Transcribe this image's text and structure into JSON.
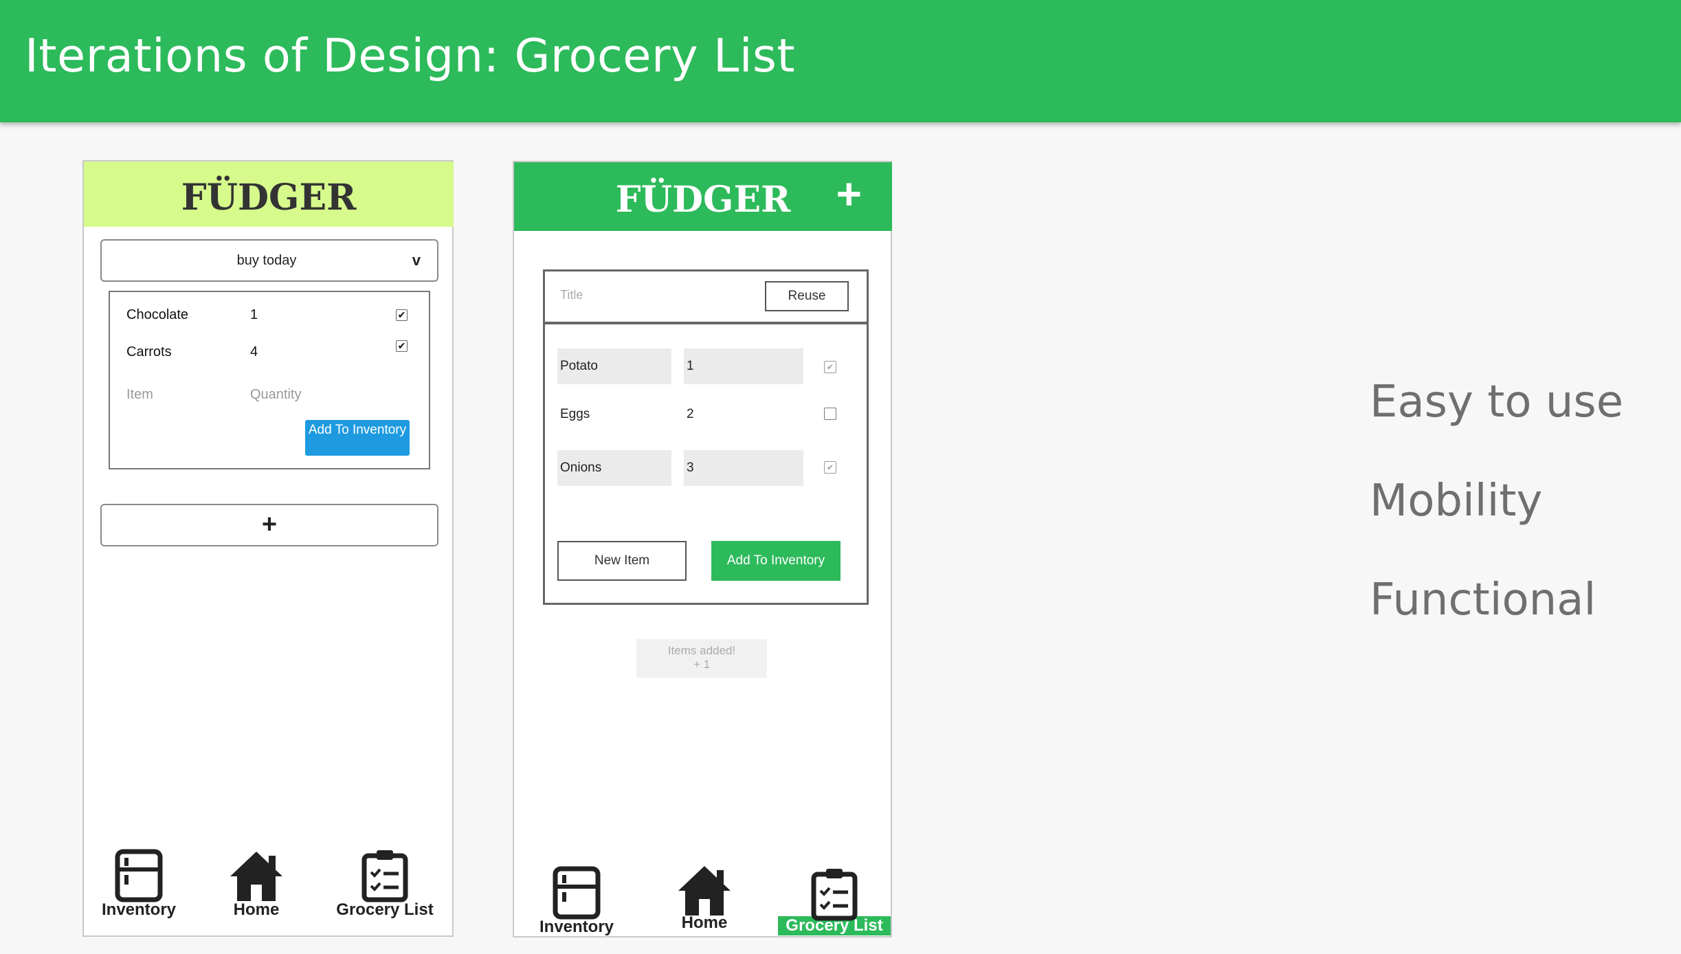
{
  "header": {
    "title": "Iterations of Design: Grocery List"
  },
  "colors": {
    "header_green": "#2dba5b",
    "lime": "#d6fb8c",
    "blue_button": "#1e9be0"
  },
  "phone1": {
    "logo": "FÜDGER",
    "select": {
      "value": "buy today",
      "chevron": "v"
    },
    "items": [
      {
        "name": "Chocolate",
        "qty": "1",
        "checked": true
      },
      {
        "name": "Carrots",
        "qty": "4",
        "checked": true
      }
    ],
    "placeholders": {
      "item": "Item",
      "quantity": "Quantity"
    },
    "add_button": "Add To Inventory",
    "plus": "+",
    "nav": {
      "inventory": "Inventory",
      "home": "Home",
      "grocery": "Grocery List"
    }
  },
  "phone2": {
    "logo": "FÜDGER",
    "plus": "+",
    "title_placeholder": "Title",
    "reuse_button": "Reuse",
    "items": [
      {
        "name": "Potato",
        "qty": "1",
        "checked": true
      },
      {
        "name": "Eggs",
        "qty": "2",
        "checked": false
      },
      {
        "name": "Onions",
        "qty": "3",
        "checked": true
      }
    ],
    "new_item_button": "New Item",
    "add_button": "Add To Inventory",
    "toast": {
      "line1": "Items added!",
      "line2": "+ 1"
    },
    "nav": {
      "inventory": "Inventory",
      "home": "Home",
      "grocery": "Grocery List"
    }
  },
  "features": [
    "Easy to use",
    "Mobility",
    "Functional"
  ]
}
